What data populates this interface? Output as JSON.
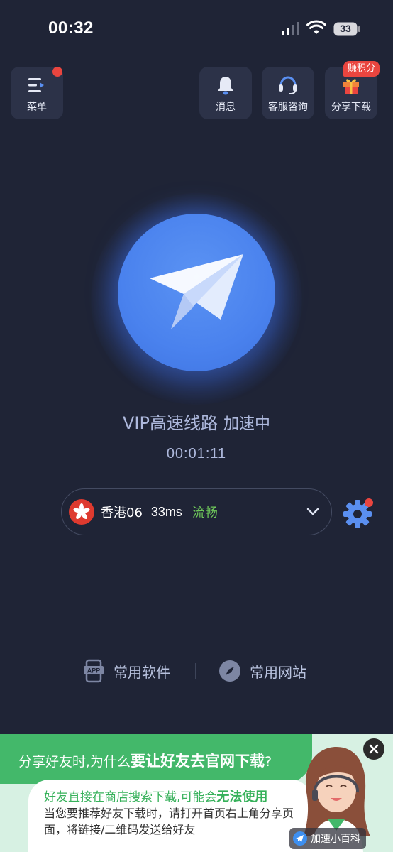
{
  "status_bar": {
    "time": "00:32",
    "battery": "33"
  },
  "top_buttons": {
    "menu": "菜单",
    "messages": "消息",
    "service": "客服咨询",
    "share": "分享下载",
    "share_badge": "赚积分"
  },
  "connection": {
    "line": "VIP高速线路",
    "state": "加速中",
    "timer": "00:01:11"
  },
  "server": {
    "name": "香港06",
    "ping": "33ms",
    "quality": "流畅"
  },
  "shortcuts": {
    "software": "常用软件",
    "website": "常用网站",
    "app_icon_text": "APP"
  },
  "banner": {
    "title_prefix": "分享好友时,为什么",
    "title_bold": "要让好友去官网下载",
    "title_suffix": "?",
    "sub_prefix": "好友直接在商店搜索下载,可能会",
    "sub_bold": "无法使用",
    "body": "当您要推荐好友下载时，请打开首页右上角分享页面，将链接/二维码发送给好友",
    "tag": "加速小百科"
  },
  "colors": {
    "background": "#1f2436",
    "accent_blue": "#4a82ee",
    "badge_red": "#e9453f",
    "quality_green": "#6fc95a",
    "banner_green": "#43b86a"
  },
  "icons": [
    "menu-icon",
    "bell-icon",
    "headset-icon",
    "gift-icon",
    "paper-plane-icon",
    "hong-kong-flag-icon",
    "chevron-down-icon",
    "gear-icon",
    "app-icon",
    "compass-icon",
    "close-icon",
    "telegram-icon"
  ]
}
